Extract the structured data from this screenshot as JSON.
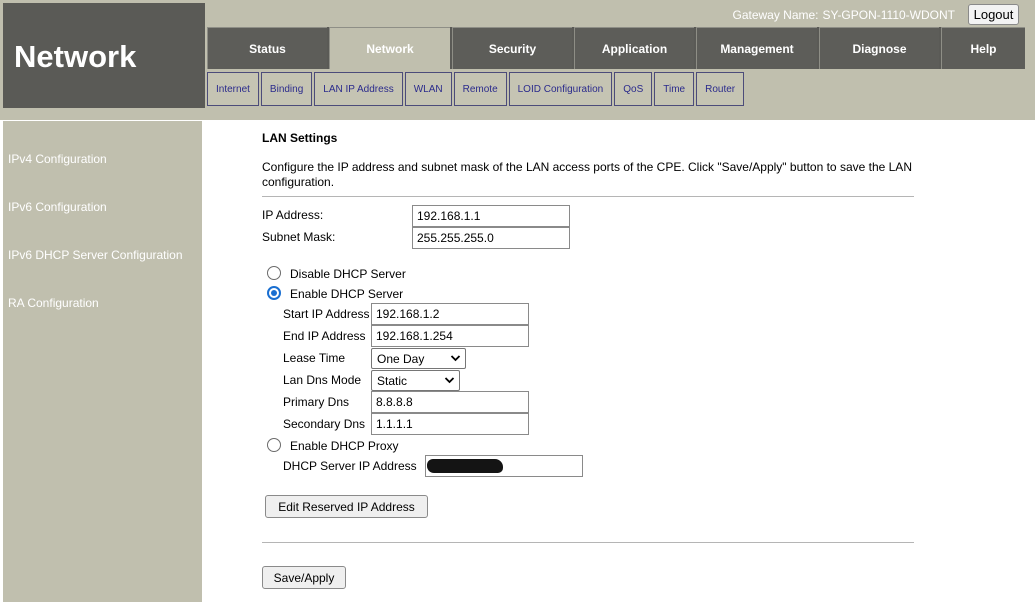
{
  "header": {
    "logo": "Network",
    "gateway_label": "Gateway Name:",
    "gateway_name": "SY-GPON-1110-WDONT",
    "logout_label": "Logout"
  },
  "main_tabs": [
    {
      "label": "Status"
    },
    {
      "label": "Network",
      "active": true
    },
    {
      "label": "Security"
    },
    {
      "label": "Application"
    },
    {
      "label": "Management"
    },
    {
      "label": "Diagnose"
    },
    {
      "label": "Help"
    }
  ],
  "sub_tabs": [
    {
      "label": "Internet"
    },
    {
      "label": "Binding"
    },
    {
      "label": "LAN IP Address"
    },
    {
      "label": "WLAN"
    },
    {
      "label": "Remote"
    },
    {
      "label": "LOID Configuration"
    },
    {
      "label": "QoS"
    },
    {
      "label": "Time"
    },
    {
      "label": "Router"
    }
  ],
  "sidebar": {
    "items": [
      {
        "label": "IPv4 Configuration"
      },
      {
        "label": "IPv6 Configuration"
      },
      {
        "label": "IPv6 DHCP Server Configuration"
      },
      {
        "label": "RA Configuration"
      }
    ]
  },
  "lan": {
    "title": "LAN Settings",
    "description": "Configure the IP address and subnet mask of the LAN access ports of the CPE. Click \"Save/Apply\" button to save the LAN configuration.",
    "ip_label": "IP Address:",
    "ip_value": "192.168.1.1",
    "mask_label": "Subnet Mask:",
    "mask_value": "255.255.255.0"
  },
  "dhcp": {
    "disable_label": "Disable DHCP Server",
    "enable_label": "Enable DHCP Server",
    "start_label": "Start IP Address",
    "start_value": "192.168.1.2",
    "end_label": "End IP Address",
    "end_value": "192.168.1.254",
    "lease_label": "Lease Time",
    "lease_value": "One Day",
    "dns_mode_label": "Lan Dns Mode",
    "dns_mode_value": "Static",
    "primary_label": "Primary Dns",
    "primary_value": "8.8.8.8",
    "secondary_label": "Secondary Dns",
    "secondary_value": "1.1.1.1",
    "proxy_label": "Enable DHCP Proxy",
    "server_ip_label": "DHCP Server IP Address",
    "server_ip_value": ""
  },
  "buttons": {
    "edit_reserved": "Edit Reserved IP Address",
    "save_apply": "Save/Apply"
  }
}
